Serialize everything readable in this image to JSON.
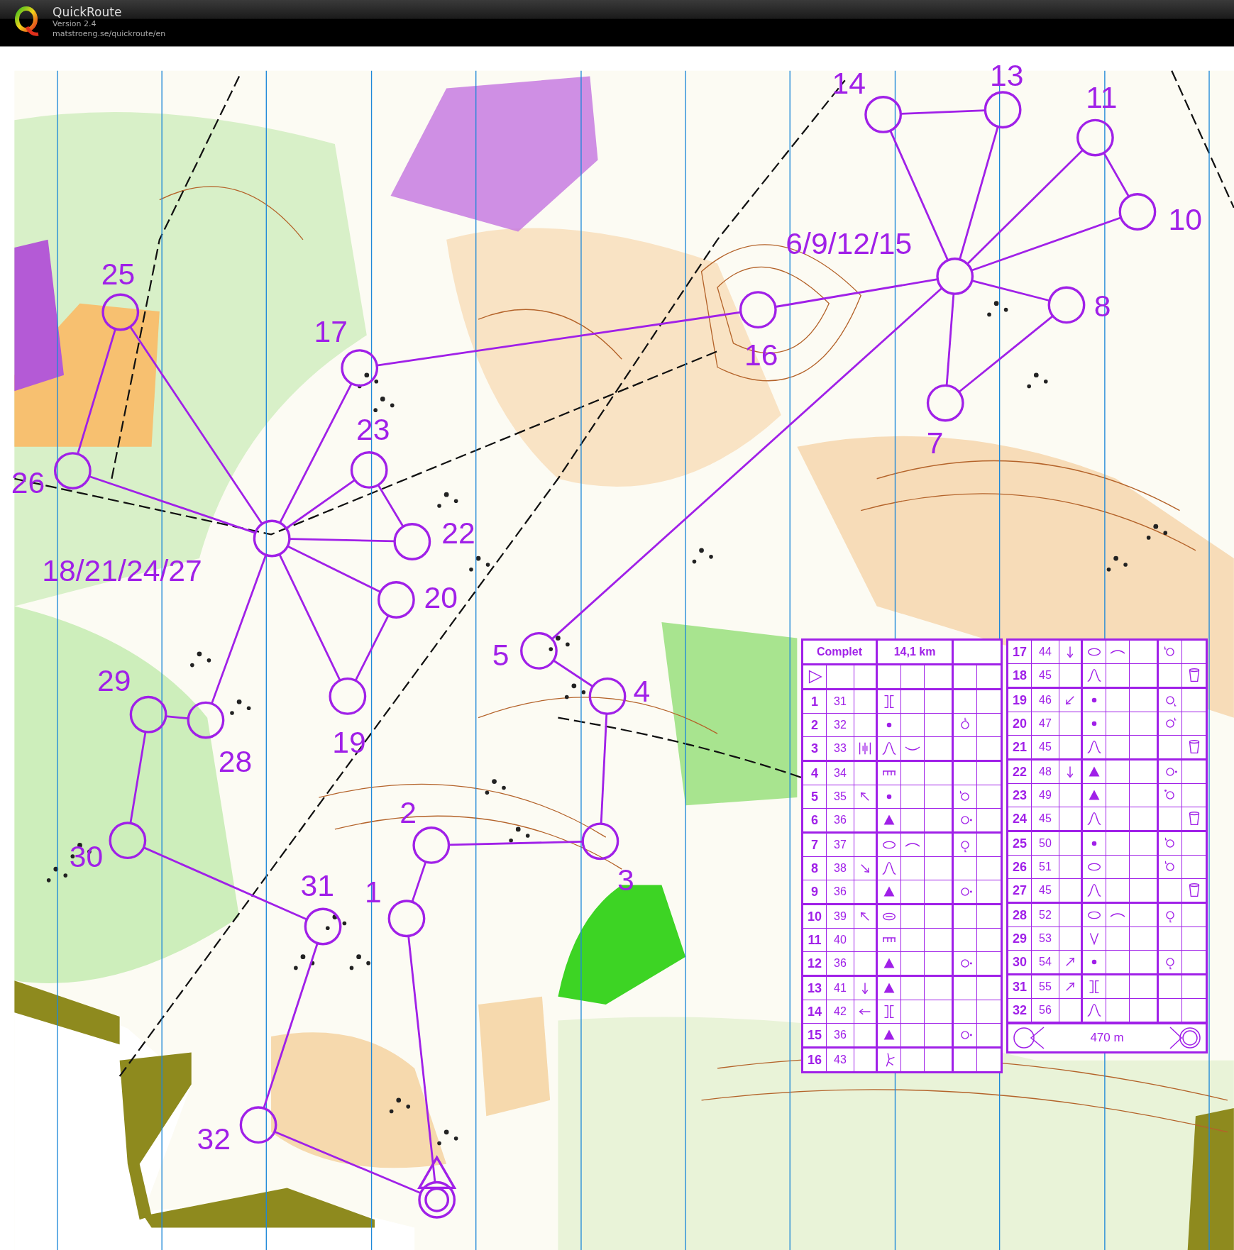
{
  "header": {
    "title": "QuickRoute",
    "version": "Version 2.4",
    "url": "matstroeng.se/quickroute/en"
  },
  "map": {
    "controls": [
      {
        "label": "1"
      },
      {
        "label": "2"
      },
      {
        "label": "3"
      },
      {
        "label": "4"
      },
      {
        "label": "5"
      },
      {
        "label": "6/9/12/15"
      },
      {
        "label": "7"
      },
      {
        "label": "8"
      },
      {
        "label": "10"
      },
      {
        "label": "11"
      },
      {
        "label": "13"
      },
      {
        "label": "14"
      },
      {
        "label": "16"
      },
      {
        "label": "17"
      },
      {
        "label": "18/21/24/27"
      },
      {
        "label": "19"
      },
      {
        "label": "20"
      },
      {
        "label": "22"
      },
      {
        "label": "23"
      },
      {
        "label": "25"
      },
      {
        "label": "26"
      },
      {
        "label": "28"
      },
      {
        "label": "29"
      },
      {
        "label": "30"
      },
      {
        "label": "31"
      },
      {
        "label": "32"
      }
    ]
  },
  "descriptions": {
    "course": "Complet",
    "length": "14,1 km",
    "distance_to_finish": "470 m",
    "rows": [
      {
        "number": "1",
        "code": "31",
        "symbols": [
          {
            "kind": "blank"
          },
          {
            "kind": "gap"
          },
          {
            "kind": "blank"
          },
          {
            "kind": "blank"
          },
          {
            "kind": "blank"
          },
          {
            "kind": "blank"
          }
        ]
      },
      {
        "number": "2",
        "code": "32",
        "symbols": [
          {
            "kind": "blank"
          },
          {
            "kind": "dot"
          },
          {
            "kind": "blank"
          },
          {
            "kind": "blank"
          },
          {
            "kind": "circle-tick-top"
          },
          {
            "kind": "blank"
          }
        ]
      },
      {
        "number": "3",
        "code": "33",
        "symbols": [
          {
            "kind": "bars"
          },
          {
            "kind": "bell"
          },
          {
            "kind": "arc-down"
          },
          {
            "kind": "blank"
          },
          {
            "kind": "blank"
          },
          {
            "kind": "blank"
          }
        ]
      },
      {
        "number": "4",
        "code": "34",
        "symbols": [
          {
            "kind": "blank"
          },
          {
            "kind": "comb"
          },
          {
            "kind": "blank"
          },
          {
            "kind": "blank"
          },
          {
            "kind": "blank"
          },
          {
            "kind": "blank"
          }
        ]
      },
      {
        "number": "5",
        "code": "35",
        "symbols": [
          {
            "kind": "arrow-nw"
          },
          {
            "kind": "dot"
          },
          {
            "kind": "blank"
          },
          {
            "kind": "blank"
          },
          {
            "kind": "circle-tick-topleft"
          },
          {
            "kind": "blank"
          }
        ]
      },
      {
        "number": "6",
        "code": "36",
        "symbols": [
          {
            "kind": "blank"
          },
          {
            "kind": "triangle"
          },
          {
            "kind": "blank"
          },
          {
            "kind": "blank"
          },
          {
            "kind": "circle-dot-right"
          },
          {
            "kind": "blank"
          }
        ]
      },
      {
        "number": "7",
        "code": "37",
        "symbols": [
          {
            "kind": "blank"
          },
          {
            "kind": "ellipse"
          },
          {
            "kind": "arc-up"
          },
          {
            "kind": "blank"
          },
          {
            "kind": "circle-tick-bottom"
          },
          {
            "kind": "blank"
          }
        ]
      },
      {
        "number": "8",
        "code": "38",
        "symbols": [
          {
            "kind": "arrow-se"
          },
          {
            "kind": "bell"
          },
          {
            "kind": "blank"
          },
          {
            "kind": "blank"
          },
          {
            "kind": "blank"
          },
          {
            "kind": "blank"
          }
        ]
      },
      {
        "number": "9",
        "code": "36",
        "symbols": [
          {
            "kind": "blank"
          },
          {
            "kind": "triangle"
          },
          {
            "kind": "blank"
          },
          {
            "kind": "blank"
          },
          {
            "kind": "circle-dot-right"
          },
          {
            "kind": "blank"
          }
        ]
      },
      {
        "number": "10",
        "code": "39",
        "symbols": [
          {
            "kind": "arrow-nw"
          },
          {
            "kind": "ellipse-bar"
          },
          {
            "kind": "blank"
          },
          {
            "kind": "blank"
          },
          {
            "kind": "blank"
          },
          {
            "kind": "blank"
          }
        ]
      },
      {
        "number": "11",
        "code": "40",
        "symbols": [
          {
            "kind": "blank"
          },
          {
            "kind": "comb"
          },
          {
            "kind": "blank"
          },
          {
            "kind": "blank"
          },
          {
            "kind": "blank"
          },
          {
            "kind": "blank"
          }
        ]
      },
      {
        "number": "12",
        "code": "36",
        "symbols": [
          {
            "kind": "blank"
          },
          {
            "kind": "triangle"
          },
          {
            "kind": "blank"
          },
          {
            "kind": "blank"
          },
          {
            "kind": "circle-dot-right"
          },
          {
            "kind": "blank"
          }
        ]
      },
      {
        "number": "13",
        "code": "41",
        "symbols": [
          {
            "kind": "arrow-s"
          },
          {
            "kind": "triangle"
          },
          {
            "kind": "blank"
          },
          {
            "kind": "blank"
          },
          {
            "kind": "blank"
          },
          {
            "kind": "blank"
          }
        ]
      },
      {
        "number": "14",
        "code": "42",
        "symbols": [
          {
            "kind": "arrow-w"
          },
          {
            "kind": "gap"
          },
          {
            "kind": "blank"
          },
          {
            "kind": "blank"
          },
          {
            "kind": "blank"
          },
          {
            "kind": "blank"
          }
        ]
      },
      {
        "number": "15",
        "code": "36",
        "symbols": [
          {
            "kind": "blank"
          },
          {
            "kind": "triangle"
          },
          {
            "kind": "blank"
          },
          {
            "kind": "blank"
          },
          {
            "kind": "circle-dot-right"
          },
          {
            "kind": "blank"
          }
        ]
      },
      {
        "number": "16",
        "code": "43",
        "symbols": [
          {
            "kind": "blank"
          },
          {
            "kind": "branch"
          },
          {
            "kind": "blank"
          },
          {
            "kind": "blank"
          },
          {
            "kind": "blank"
          },
          {
            "kind": "blank"
          }
        ]
      },
      {
        "number": "17",
        "code": "44",
        "symbols": [
          {
            "kind": "arrow-s"
          },
          {
            "kind": "ellipse"
          },
          {
            "kind": "arc-up"
          },
          {
            "kind": "blank"
          },
          {
            "kind": "circle-tick-left"
          },
          {
            "kind": "blank"
          }
        ]
      },
      {
        "number": "18",
        "code": "45",
        "symbols": [
          {
            "kind": "blank"
          },
          {
            "kind": "bell"
          },
          {
            "kind": "blank"
          },
          {
            "kind": "blank"
          },
          {
            "kind": "blank"
          },
          {
            "kind": "cup"
          }
        ]
      },
      {
        "number": "19",
        "code": "46",
        "symbols": [
          {
            "kind": "arrow-sw"
          },
          {
            "kind": "dot"
          },
          {
            "kind": "blank"
          },
          {
            "kind": "blank"
          },
          {
            "kind": "circle-tick-bottomright"
          },
          {
            "kind": "blank"
          }
        ]
      },
      {
        "number": "20",
        "code": "47",
        "symbols": [
          {
            "kind": "blank"
          },
          {
            "kind": "dot"
          },
          {
            "kind": "blank"
          },
          {
            "kind": "blank"
          },
          {
            "kind": "circle-tick-topright"
          },
          {
            "kind": "blank"
          }
        ]
      },
      {
        "number": "21",
        "code": "45",
        "symbols": [
          {
            "kind": "blank"
          },
          {
            "kind": "bell"
          },
          {
            "kind": "blank"
          },
          {
            "kind": "blank"
          },
          {
            "kind": "blank"
          },
          {
            "kind": "cup"
          }
        ]
      },
      {
        "number": "22",
        "code": "48",
        "symbols": [
          {
            "kind": "arrow-s"
          },
          {
            "kind": "triangle"
          },
          {
            "kind": "blank"
          },
          {
            "kind": "blank"
          },
          {
            "kind": "circle-dot-right"
          },
          {
            "kind": "blank"
          }
        ]
      },
      {
        "number": "23",
        "code": "49",
        "symbols": [
          {
            "kind": "blank"
          },
          {
            "kind": "triangle"
          },
          {
            "kind": "blank"
          },
          {
            "kind": "blank"
          },
          {
            "kind": "circle-dot-topleft"
          },
          {
            "kind": "blank"
          }
        ]
      },
      {
        "number": "24",
        "code": "45",
        "symbols": [
          {
            "kind": "blank"
          },
          {
            "kind": "bell"
          },
          {
            "kind": "blank"
          },
          {
            "kind": "blank"
          },
          {
            "kind": "blank"
          },
          {
            "kind": "cup"
          }
        ]
      },
      {
        "number": "25",
        "code": "50",
        "symbols": [
          {
            "kind": "blank"
          },
          {
            "kind": "dot"
          },
          {
            "kind": "blank"
          },
          {
            "kind": "blank"
          },
          {
            "kind": "circle-tick-topleft"
          },
          {
            "kind": "blank"
          }
        ]
      },
      {
        "number": "26",
        "code": "51",
        "symbols": [
          {
            "kind": "blank"
          },
          {
            "kind": "ellipse"
          },
          {
            "kind": "blank"
          },
          {
            "kind": "blank"
          },
          {
            "kind": "circle-tick-topleft"
          },
          {
            "kind": "blank"
          }
        ]
      },
      {
        "number": "27",
        "code": "45",
        "symbols": [
          {
            "kind": "blank"
          },
          {
            "kind": "bell"
          },
          {
            "kind": "blank"
          },
          {
            "kind": "blank"
          },
          {
            "kind": "blank"
          },
          {
            "kind": "cup"
          }
        ]
      },
      {
        "number": "28",
        "code": "52",
        "symbols": [
          {
            "kind": "blank"
          },
          {
            "kind": "ellipse"
          },
          {
            "kind": "arc-up"
          },
          {
            "kind": "blank"
          },
          {
            "kind": "circle-tick-bottom"
          },
          {
            "kind": "blank"
          }
        ]
      },
      {
        "number": "29",
        "code": "53",
        "symbols": [
          {
            "kind": "blank"
          },
          {
            "kind": "v"
          },
          {
            "kind": "blank"
          },
          {
            "kind": "blank"
          },
          {
            "kind": "blank"
          },
          {
            "kind": "blank"
          }
        ]
      },
      {
        "number": "30",
        "code": "54",
        "symbols": [
          {
            "kind": "arrow-ne"
          },
          {
            "kind": "dot"
          },
          {
            "kind": "blank"
          },
          {
            "kind": "blank"
          },
          {
            "kind": "circle-tick-bottom"
          },
          {
            "kind": "blank"
          }
        ]
      },
      {
        "number": "31",
        "code": "55",
        "symbols": [
          {
            "kind": "arrow-ne"
          },
          {
            "kind": "gap"
          },
          {
            "kind": "blank"
          },
          {
            "kind": "blank"
          },
          {
            "kind": "blank"
          },
          {
            "kind": "blank"
          }
        ]
      },
      {
        "number": "32",
        "code": "56",
        "symbols": [
          {
            "kind": "blank"
          },
          {
            "kind": "bell"
          },
          {
            "kind": "blank"
          },
          {
            "kind": "blank"
          },
          {
            "kind": "blank"
          },
          {
            "kind": "blank"
          }
        ]
      }
    ]
  }
}
